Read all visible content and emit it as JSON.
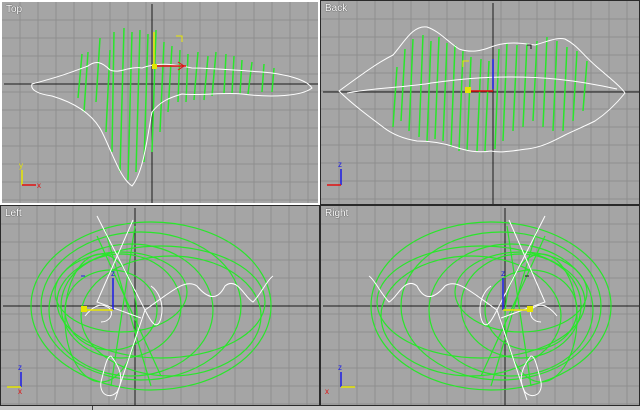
{
  "viewports": {
    "top": {
      "label": "Top"
    },
    "back": {
      "label": "Back"
    },
    "left": {
      "label": "Left"
    },
    "right": {
      "label": "Right"
    }
  },
  "colors": {
    "viewport_bg": "#a5a5a5",
    "grid_minor": "#8f8f8f",
    "axis_line": "#1a1a1a",
    "spline_green": "#29e62b",
    "spline_white": "#ffffff",
    "gizmo_x": "#e01010",
    "gizmo_y": "#e6e600",
    "gizmo_z": "#1a1ae6",
    "active_border": "#ffffff"
  },
  "icons": [
    "axis-tripod-icon",
    "transform-gizmo-icon",
    "camera-bracket-icon"
  ]
}
